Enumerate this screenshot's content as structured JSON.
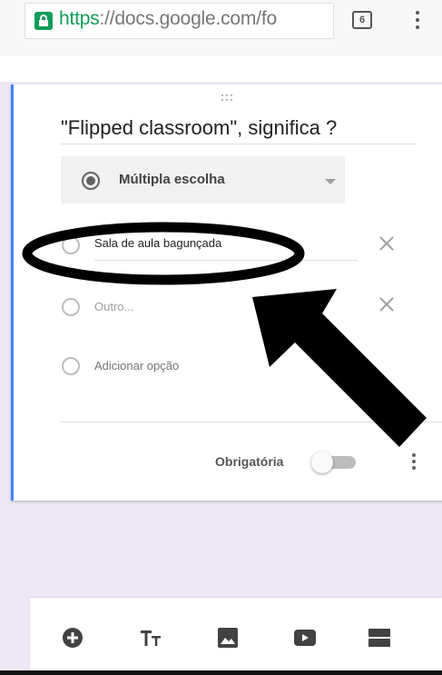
{
  "browser": {
    "url_scheme": "https",
    "url_rest": "://docs.google.com/fo",
    "tab_count": "6"
  },
  "question": {
    "title": "\"Flipped classroom\", significa ?",
    "type_label": "Múltipla escolha",
    "options": [
      {
        "label": "Sala de aula bagunçada",
        "state": "filled"
      },
      {
        "label": "Outro...",
        "state": "placeholder"
      },
      {
        "label": "Adicionar opção",
        "state": "action"
      }
    ],
    "required_label": "Obrigatória",
    "required_on": false
  },
  "toolbar": {
    "icons": [
      "add-question-icon",
      "title-text-icon",
      "image-icon",
      "video-icon",
      "section-icon"
    ]
  },
  "colors": {
    "accent": "#4285f4",
    "secure_green": "#0f9d58",
    "background_purple": "#ede7f6"
  }
}
